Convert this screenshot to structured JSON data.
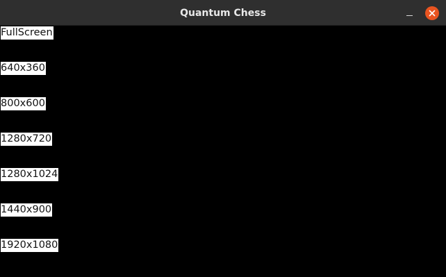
{
  "window": {
    "title": "Quantum Chess",
    "minimize_icon": "minimize-icon",
    "close_icon": "close-icon",
    "close_color": "#e95420"
  },
  "menu": {
    "background": "#000000",
    "options": [
      "FullScreen",
      "640x360",
      "800x600",
      "1280x720",
      "1280x1024",
      "1440x900",
      "1920x1080"
    ]
  }
}
